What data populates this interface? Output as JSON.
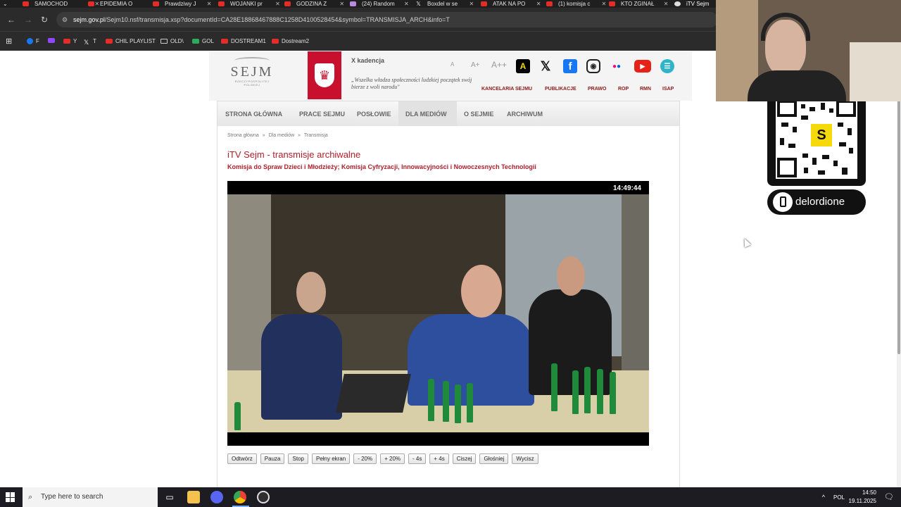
{
  "browser": {
    "tabs": [
      {
        "label": "SAMOCHOD",
        "icon": "youtube-icon"
      },
      {
        "label": "EPIDEMIA O",
        "icon": "youtube-icon"
      },
      {
        "label": "Prawdziwy J",
        "icon": "youtube-icon"
      },
      {
        "label": "WOJANKI pr",
        "icon": "youtube-icon"
      },
      {
        "label": "GODZINA Z",
        "icon": "youtube-icon"
      },
      {
        "label": "(24) Random",
        "icon": "twitch-icon"
      },
      {
        "label": "Boxdel w se",
        "icon": "x-icon"
      },
      {
        "label": "ATAK NA PO",
        "icon": "youtube-icon"
      },
      {
        "label": "(1) komisja c",
        "icon": "youtube-icon"
      },
      {
        "label": "KTO ZGINAŁ",
        "icon": "youtube-icon"
      },
      {
        "label": "iTV Sejm",
        "icon": "sejm-icon",
        "active": true
      }
    ],
    "url_domain": "sejm.gov.pl",
    "url_path": "/Sejm10.nsf/transmisja.xsp?documentId=CA28E18868467888C1258D4100528454&symbol=TRANSMISJA_ARCH&info=T",
    "bookmarks": [
      {
        "label": "F",
        "icon": "facebook-icon"
      },
      {
        "label": "",
        "icon": "twitch-icon"
      },
      {
        "label": "Y",
        "icon": "youtube-icon"
      },
      {
        "label": "T",
        "icon": "x-icon"
      },
      {
        "label": "CHIL PLAYLIST",
        "icon": "youtube-icon"
      },
      {
        "label": "OLD\\",
        "icon": "folder-icon"
      },
      {
        "label": "GOL",
        "icon": "gol-icon"
      },
      {
        "label": "DOSTREAM1",
        "icon": "youtube-icon"
      },
      {
        "label": "Dostream2",
        "icon": "youtube-icon"
      }
    ]
  },
  "site": {
    "logo_word": "SEJM",
    "logo_sub": "RZECZYPOSPOLITEJ POLSKIEJ",
    "kadencja": "X kadencja",
    "motto": "„Wszelka władza społeczności ludzkiej początek swój bierze z woli narodu\"",
    "font_sizes": [
      "A",
      "A+",
      "A++"
    ],
    "top_links": [
      "KANCELARIA SEJMU",
      "PUBLIKACJE",
      "PRAWO",
      "ROP",
      "RMN",
      "ISAP"
    ],
    "nav": [
      "STRONA GŁÓWNA",
      "PRACE SEJMU",
      "POSŁOWIE",
      "DLA MEDIÓW",
      "O SEJMIE",
      "ARCHIWUM"
    ],
    "nav_active": "DLA MEDIÓW",
    "breadcrumb": {
      "home": "Strona główna",
      "sep": "»",
      "section": "Dla mediów",
      "page": "Transmisja"
    },
    "title": "iTV Sejm - transmisje archiwalne",
    "subtitle": "Komisja do Spraw Dzieci i Młodzieży; Komisja Cyfryzacji, Innowacyjności i Nowoczesnych Technologii",
    "timecode": "14:49:44",
    "controls": [
      "Odtwórz",
      "Pauza",
      "Stop",
      "Pełny ekran",
      "- 20%",
      "+ 20%",
      "- 4s",
      "+ 4s",
      "Ciszej",
      "Głośniej",
      "Wycisz"
    ]
  },
  "overlay": {
    "qr_letter": "S",
    "handle": "delordione"
  },
  "taskbar": {
    "search_placeholder": "Type here to search",
    "language": "POL",
    "time": "14:50",
    "date": "19.11.2025"
  }
}
